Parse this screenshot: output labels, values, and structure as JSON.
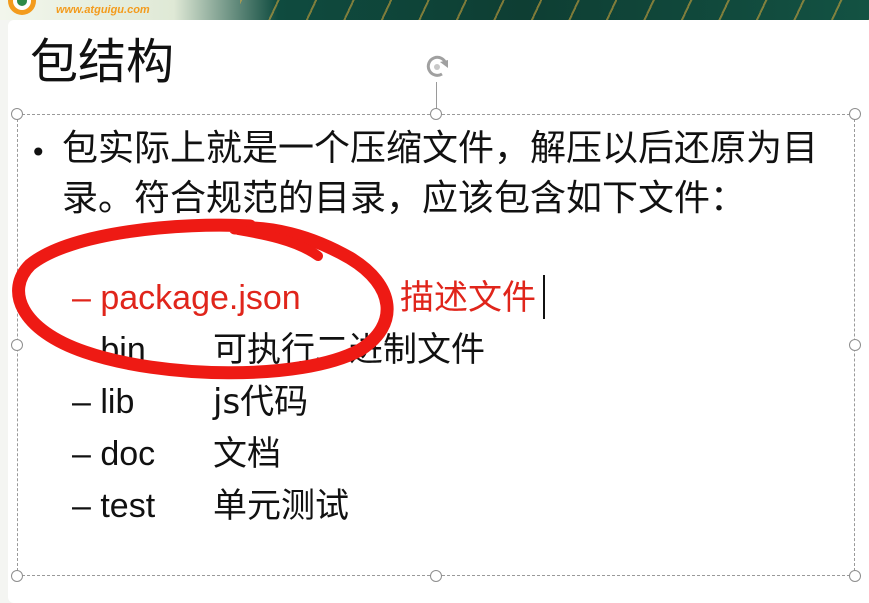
{
  "header": {
    "url": "www.atguigu.com"
  },
  "slide": {
    "title": "包结构",
    "paragraph": "包实际上就是一个压缩文件，解压以后还原为目录。符合规范的目录，应该包含如下文件：",
    "items": [
      {
        "name": "– package.json",
        "desc": "描述文件"
      },
      {
        "name": "– bin",
        "desc": "可执行二进制文件"
      },
      {
        "name": "– lib",
        "desc": "js代码"
      },
      {
        "name": "– doc",
        "desc": "文档"
      },
      {
        "name": "– test",
        "desc": "单元测试"
      }
    ]
  },
  "colors": {
    "highlight": "#e0251b",
    "text": "#111111",
    "banner": "#0f4b3f",
    "logo": "#f39b1d"
  },
  "icons": [
    "logo-icon",
    "rotate-handle-icon",
    "bullet-icon"
  ]
}
